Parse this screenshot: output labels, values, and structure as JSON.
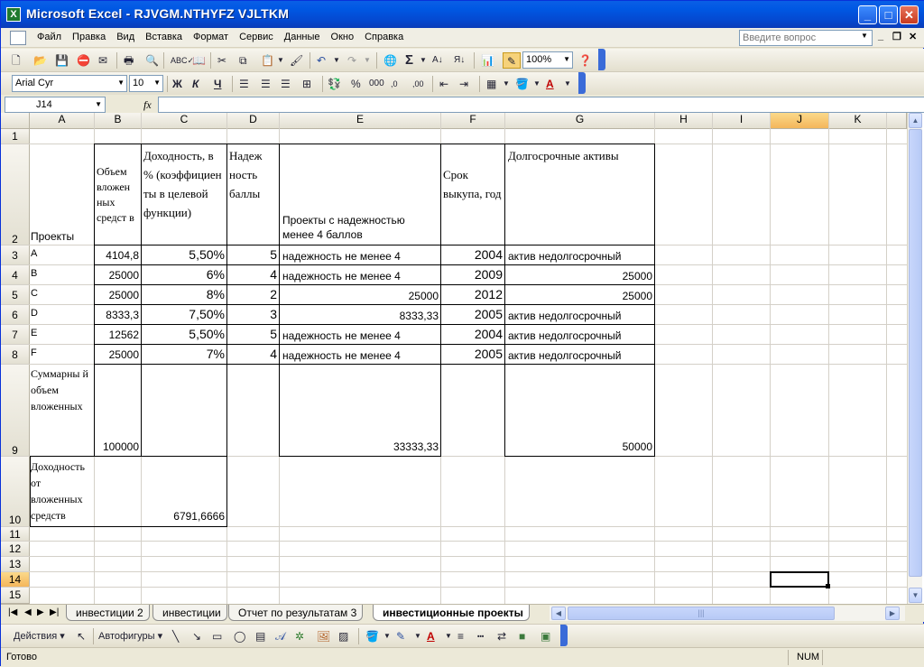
{
  "window": {
    "title": "Microsoft Excel - RJVGM.NTHYFZ VJLTKM",
    "app_icon_glyph": "X",
    "minimize": "_",
    "maximize": "□",
    "close": "✕"
  },
  "menubar": {
    "items": [
      "Файл",
      "Правка",
      "Вид",
      "Вставка",
      "Формат",
      "Сервис",
      "Данные",
      "Окно",
      "Справка"
    ],
    "help_placeholder": "Введите вопрос",
    "mdi_min": "_",
    "mdi_restore": "❐",
    "mdi_close": "✕"
  },
  "standard_toolbar": {
    "zoom": "100%",
    "sigma": "Σ"
  },
  "format_toolbar": {
    "font": "Arial Cyr",
    "size": "10",
    "bold": "Ж",
    "italic": "К",
    "underline": "Ч",
    "percent": "%",
    "thousands": "000"
  },
  "formula_bar": {
    "name_box": "J14",
    "fx": "fx",
    "formula": ""
  },
  "columns": [
    "A",
    "B",
    "C",
    "D",
    "E",
    "F",
    "G",
    "H",
    "I",
    "J",
    "K"
  ],
  "rows": [
    "1",
    "2",
    "3",
    "4",
    "5",
    "6",
    "7",
    "8",
    "9",
    "10",
    "11",
    "12",
    "13",
    "14",
    "15"
  ],
  "selected_cell": "J14",
  "sheet": {
    "a2": "Проекты",
    "b2": "Объем вложен ных средст в",
    "c2": "Доходность, в % (коэффициен ты в целевой функции)",
    "d2": "Надеж ность баллы",
    "e2": "Проекты с надежностью менее 4 баллов",
    "f2": "Срок выкупа, год",
    "g2": "Долгосрочные активы",
    "projects": [
      {
        "a": "A",
        "b": "4104,8",
        "c": "5,50%",
        "d": "5",
        "e": "надежность не менее 4",
        "f": "2004",
        "g": "актив недолгосрочный"
      },
      {
        "a": "B",
        "b": "25000",
        "c": "6%",
        "d": "4",
        "e": "надежность не менее 4",
        "f": "2009",
        "g": "25000"
      },
      {
        "a": "C",
        "b": "25000",
        "c": "8%",
        "d": "2",
        "e": "25000",
        "f": "2012",
        "g": "25000"
      },
      {
        "a": "D",
        "b": "8333,3",
        "c": "7,50%",
        "d": "3",
        "e": "8333,33",
        "f": "2005",
        "g": "актив недолгосрочный"
      },
      {
        "a": "E",
        "b": "12562",
        "c": "5,50%",
        "d": "5",
        "e": "надежность не менее 4",
        "f": "2004",
        "g": "актив недолгосрочный"
      },
      {
        "a": "F",
        "b": "25000",
        "c": "7%",
        "d": "4",
        "e": "надежность не менее 4",
        "f": "2005",
        "g": "актив недолгосрочный"
      }
    ],
    "a9": "Суммарны й объем вложенных средств",
    "b9": "100000",
    "e9": "33333,33",
    "g9": "50000",
    "a10": "Доходность от вложенных средств",
    "c10": "6791,6666"
  },
  "sheet_tabs": [
    "инвестиции 2",
    "инвестиции",
    "Отчет по результатам 3",
    "инвестиционные проекты"
  ],
  "active_tab": "инвестиционные проекты",
  "drawing_toolbar": {
    "actions": "Действия",
    "autoshapes": "Автофигуры"
  },
  "status": {
    "ready": "Готово",
    "num": "NUM"
  }
}
